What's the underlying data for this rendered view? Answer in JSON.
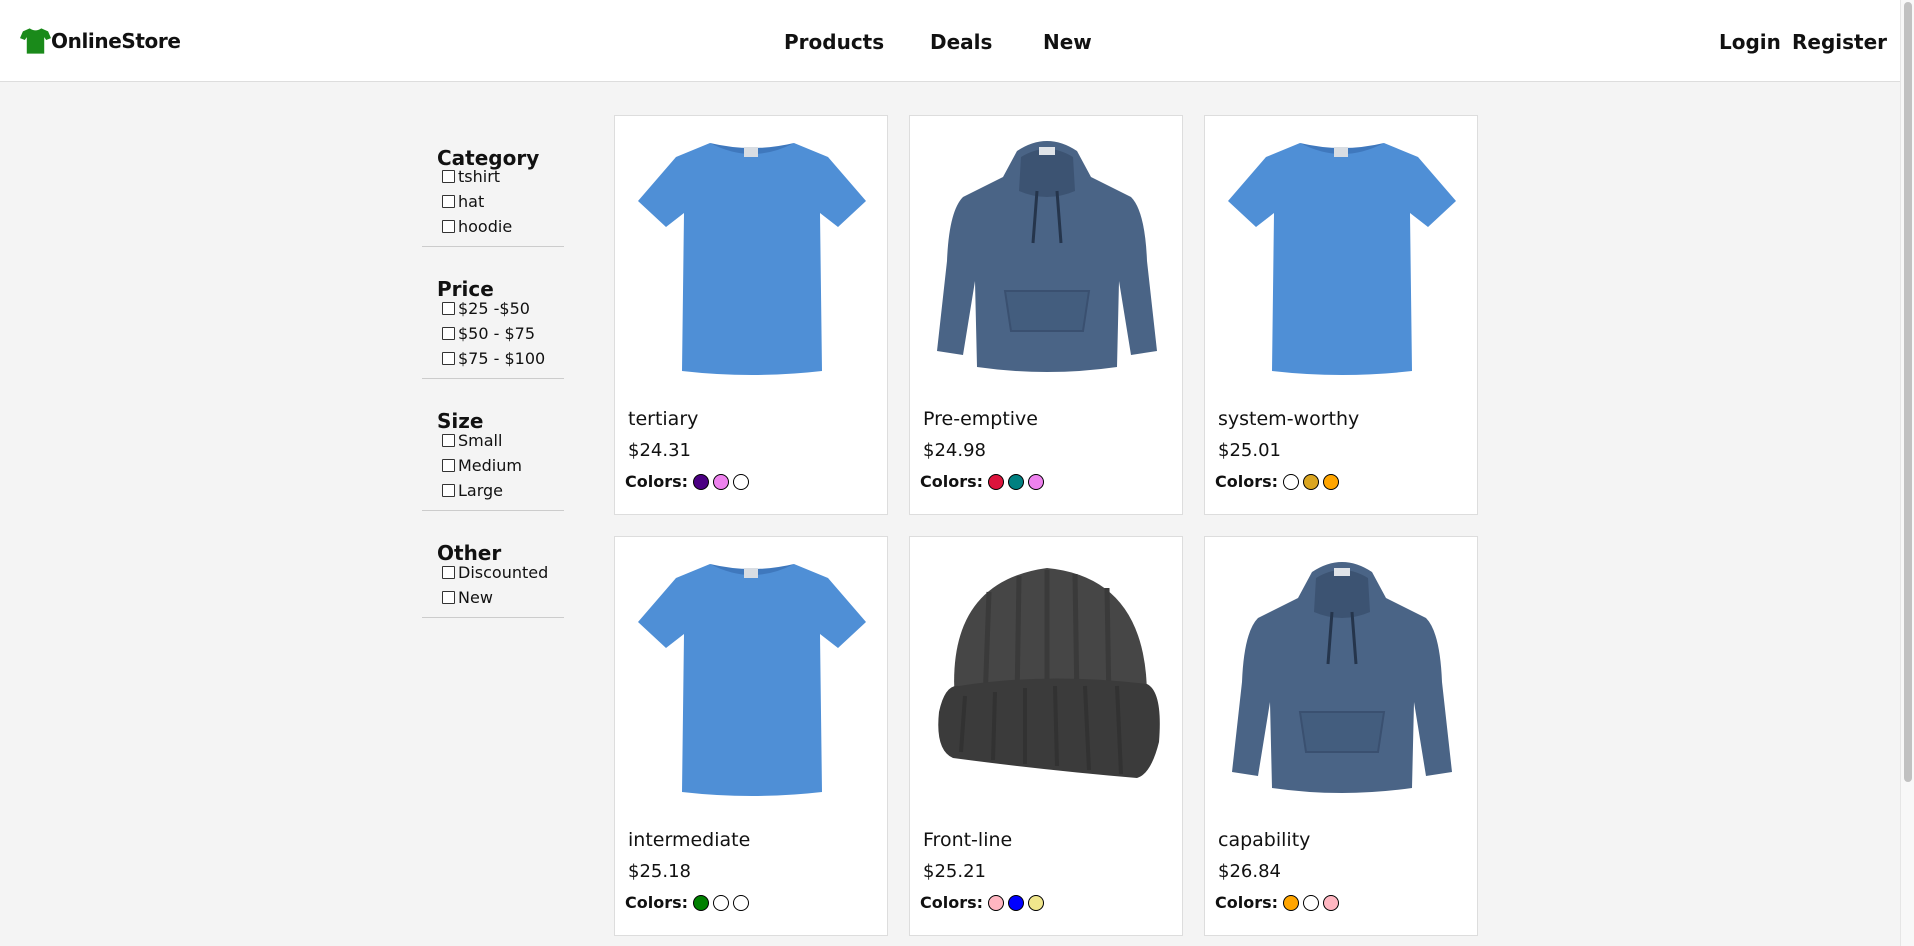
{
  "brand": {
    "name": "OnlineStore",
    "logo_color": "#1a8a1a",
    "logo_icon": "tshirt-icon"
  },
  "nav": {
    "links": [
      "Products",
      "Deals",
      "New"
    ],
    "login": "Login",
    "register": "Register"
  },
  "filters": [
    {
      "title": "Category",
      "options": [
        "tshirt",
        "hat",
        "hoodie"
      ]
    },
    {
      "title": "Price",
      "options": [
        "$25 -$50",
        "$50 - $75",
        "$75 - $100"
      ]
    },
    {
      "title": "Size",
      "options": [
        "Small",
        "Medium",
        "Large"
      ]
    },
    {
      "title": "Other",
      "options": [
        "Discounted",
        "New"
      ]
    }
  ],
  "colors_label": "Colors:",
  "products": [
    {
      "name": "tertiary",
      "price": "$24.31",
      "image": "tshirt",
      "colors": [
        "#4b0082",
        "#ee82ee",
        "#ffffff"
      ]
    },
    {
      "name": "Pre-emptive",
      "price": "$24.98",
      "image": "hoodie",
      "colors": [
        "#dc143c",
        "#008080",
        "#ee82ee"
      ]
    },
    {
      "name": "system-worthy",
      "price": "$25.01",
      "image": "tshirt",
      "colors": [
        "#ffffff",
        "#daa520",
        "#ffa500"
      ]
    },
    {
      "name": "intermediate",
      "price": "$25.18",
      "image": "tshirt",
      "colors": [
        "#008000",
        "#ffffff",
        "#ffffff"
      ]
    },
    {
      "name": "Front-line",
      "price": "$25.21",
      "image": "beanie",
      "colors": [
        "#ffb6c1",
        "#0000ff",
        "#f0e68c"
      ]
    },
    {
      "name": "capability",
      "price": "$26.84",
      "image": "hoodie",
      "colors": [
        "#ffa500",
        "#ffffff",
        "#ffb6c1"
      ]
    }
  ]
}
